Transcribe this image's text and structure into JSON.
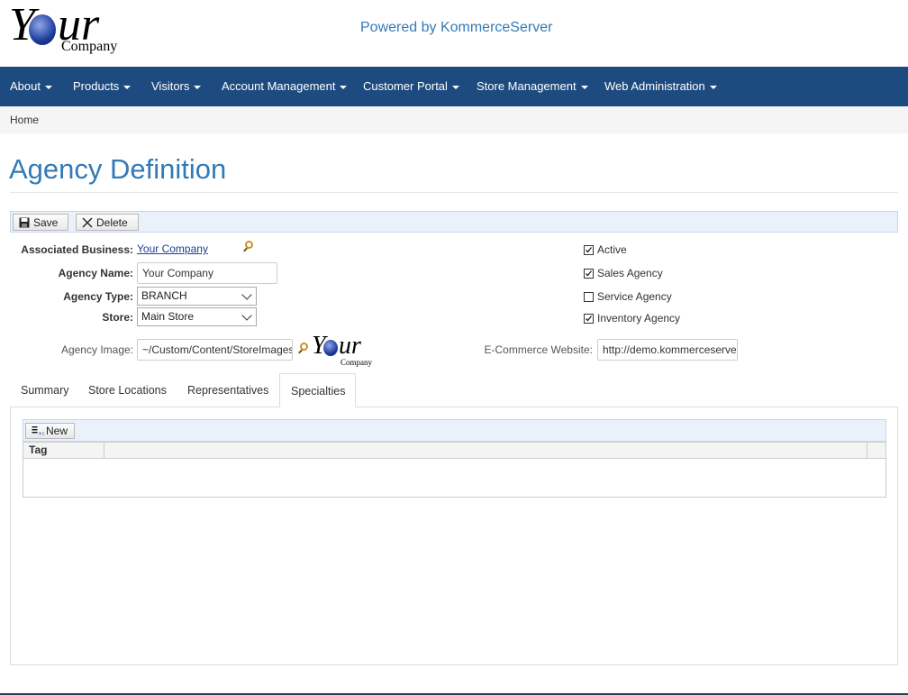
{
  "header": {
    "logo": {
      "y": "Y",
      "ur": "ur",
      "company": "Company"
    },
    "powered_by": "Powered by KommerceServer"
  },
  "nav": {
    "items": [
      {
        "label": "About"
      },
      {
        "label": "Products"
      },
      {
        "label": "Visitors"
      },
      {
        "label": "Account Management"
      },
      {
        "label": "Customer Portal"
      },
      {
        "label": "Store Management"
      },
      {
        "label": "Web Administration"
      }
    ]
  },
  "breadcrumb": {
    "home": "Home"
  },
  "page": {
    "title": "Agency Definition"
  },
  "toolbar": {
    "save_label": "Save",
    "delete_label": "Delete"
  },
  "form": {
    "associated_business_label": "Associated Business:",
    "associated_business_value": "Your Company",
    "agency_name_label": "Agency Name:",
    "agency_name_value": "Your Company",
    "agency_type_label": "Agency Type:",
    "agency_type_value": "BRANCH",
    "store_label": "Store:",
    "store_value": "Main Store",
    "agency_image_label": "Agency Image:",
    "agency_image_value": "~/Custom/Content/StoreImages/",
    "ecommerce_label": "E-Commerce Website:",
    "ecommerce_value": "http://demo.kommerceserver",
    "checkboxes": {
      "active": {
        "label": "Active",
        "checked": true
      },
      "sales": {
        "label": "Sales Agency",
        "checked": true
      },
      "service": {
        "label": "Service Agency",
        "checked": false
      },
      "inventory": {
        "label": "Inventory Agency",
        "checked": true
      }
    }
  },
  "tabs": {
    "summary": "Summary",
    "store_locations": "Store Locations",
    "representatives": "Representatives",
    "specialties": "Specialties",
    "active": "specialties"
  },
  "grid": {
    "new_label": "New",
    "columns": [
      "Tag",
      ""
    ]
  }
}
